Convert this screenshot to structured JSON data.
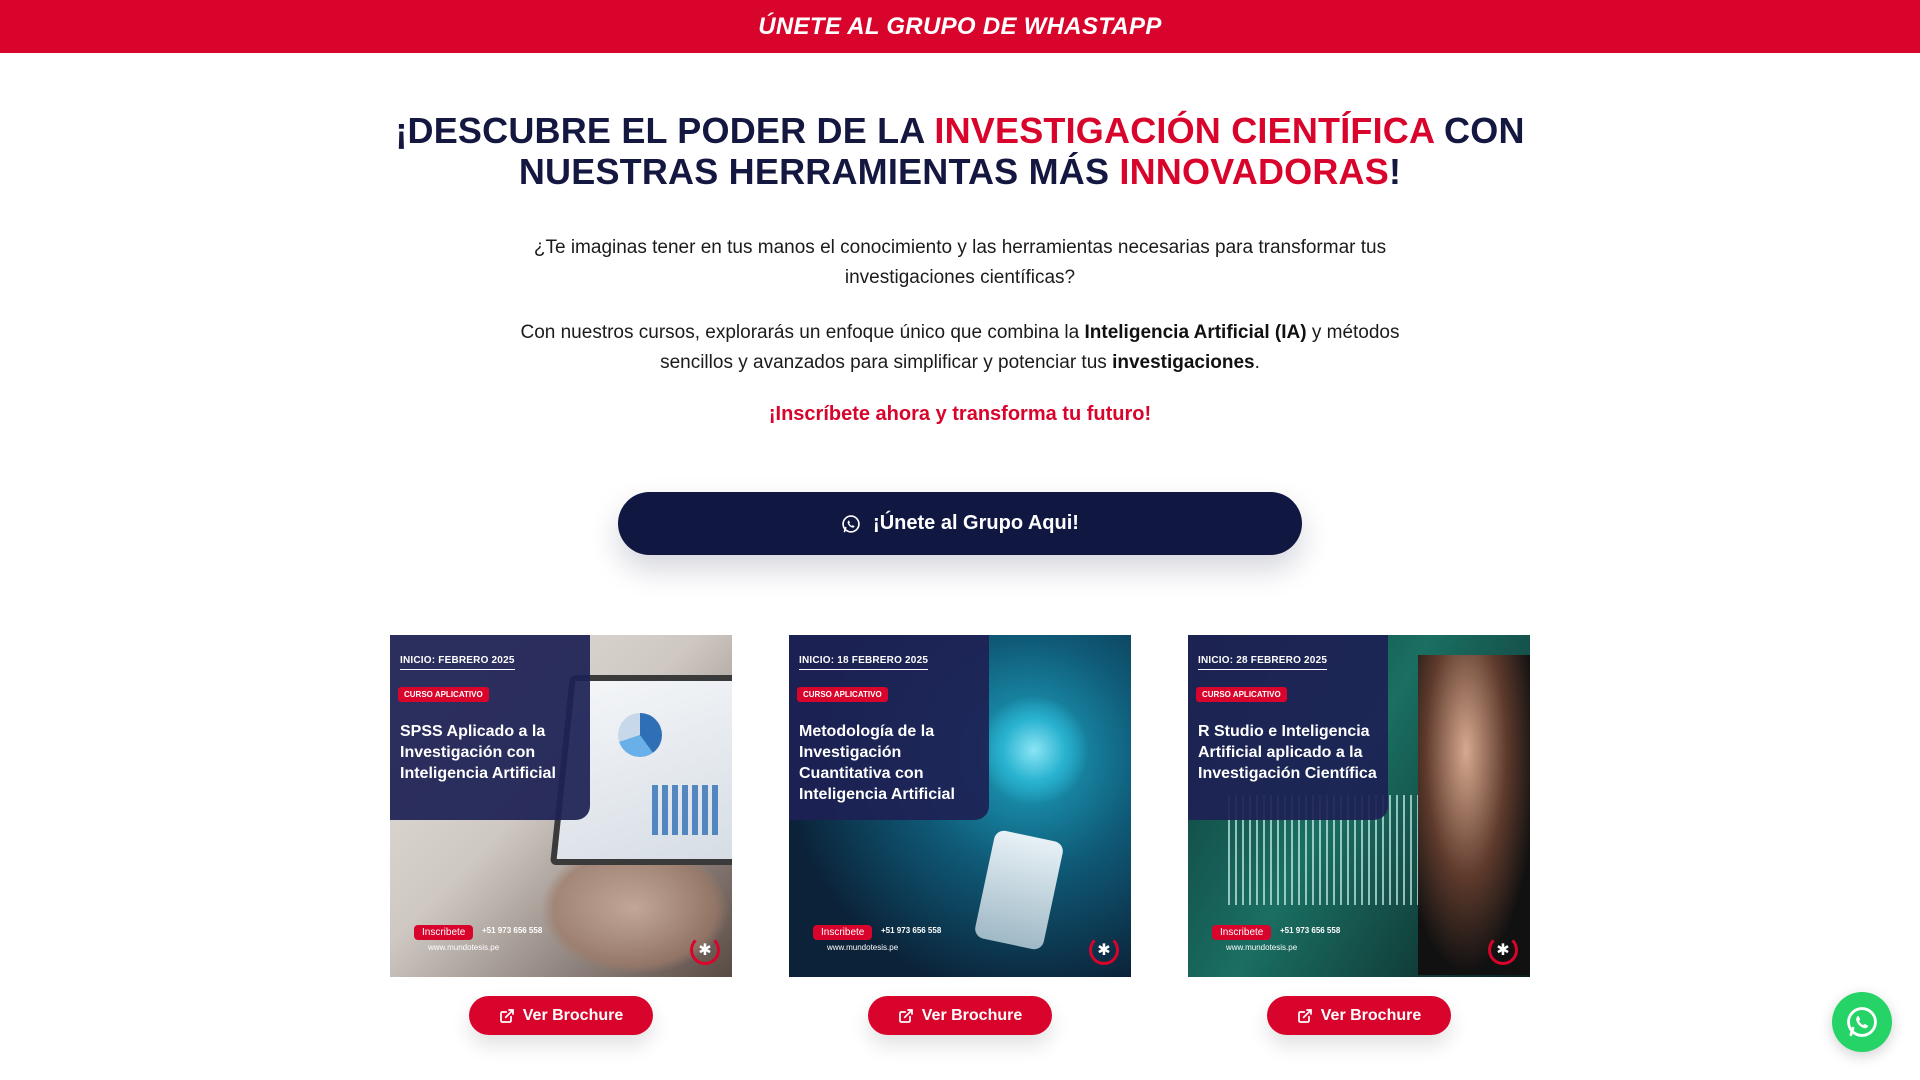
{
  "topbar": {
    "text": "ÚNETE AL GRUPO DE WHASTAPP"
  },
  "hero": {
    "line1_a": "¡DESCUBRE EL PODER DE LA ",
    "line1_b": "INVESTIGACIÓN CIENTÍFICA",
    "line1_c": " CON",
    "line2_a": "NUESTRAS HERRAMIENTAS MÁS ",
    "line2_b": "INNOVADORAS",
    "line2_c": "!"
  },
  "intro": {
    "p1_line1": "¿Te imaginas tener en tus manos el conocimiento y las herramientas necesarias para transformar tus",
    "p1_line2": "investigaciones científicas?",
    "p2_a": "Con nuestros cursos, explorarás un enfoque único que combina la ",
    "p2_b": "Inteligencia Artificial (IA)",
    "p2_c": " y métodos",
    "p2_d": "sencillos y avanzados para simplificar y potenciar tus ",
    "p2_e": "investigaciones",
    "p2_f": ".",
    "cta": "¡Inscríbete ahora y transforma tu futuro!"
  },
  "join_button": {
    "label": "¡Únete al Grupo Aqui!"
  },
  "courses": [
    {
      "inicio_prefix": "INICIO:",
      "inicio_date": " FEBRERO 2025",
      "tag": "CURSO APLICATIVO",
      "title": "SPSS Aplicado a la Investigación con Inteligencia Artificial",
      "inscribete": "Inscribete",
      "phone": "+51 973 656 558",
      "web": "www.mundotesis.pe",
      "brochure": "Ver Brochure"
    },
    {
      "inicio_prefix": "INICIO:",
      "inicio_date": " 18 FEBRERO 2025",
      "tag": "CURSO APLICATIVO",
      "title": "Metodología de la Investigación Cuantitativa con Inteligencia Artificial",
      "inscribete": "Inscribete",
      "phone": "+51 973 656 558",
      "web": "www.mundotesis.pe",
      "brochure": "Ver Brochure"
    },
    {
      "inicio_prefix": "INICIO:",
      "inicio_date": " 28 FEBRERO 2025",
      "tag": "CURSO APLICATIVO",
      "title": "R Studio e Inteligencia Artificial aplicado a la Investigación Científica",
      "inscribete": "Inscribete",
      "phone": "+51 973 656 558",
      "web": "www.mundotesis.pe",
      "brochure": "Ver Brochure"
    }
  ],
  "icons": {
    "whatsapp": "whatsapp-icon",
    "external_link": "external-link-icon"
  },
  "colors": {
    "brand_red": "#d9042b",
    "navy": "#101741",
    "whatsapp_green": "#25d366"
  }
}
